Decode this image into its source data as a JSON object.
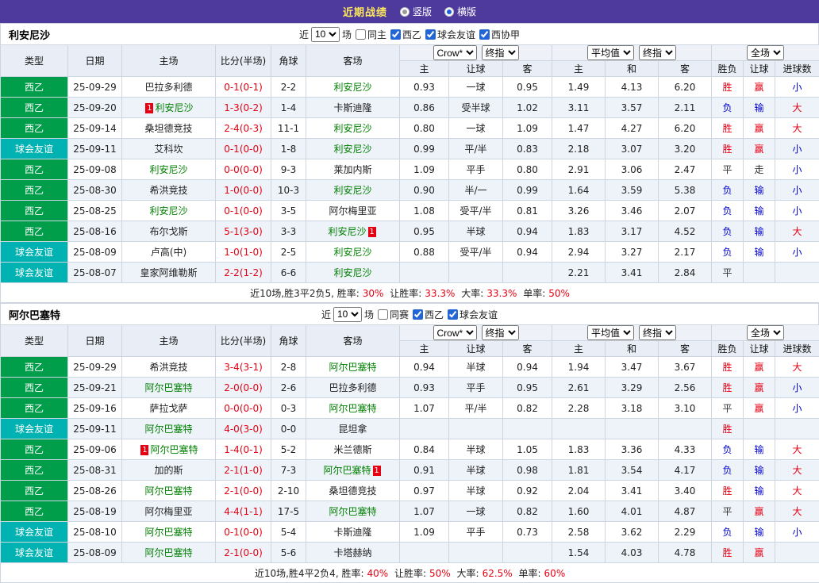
{
  "topbar": {
    "title": "近期战绩",
    "vertical_label": "竖版",
    "horizontal_label": "横版",
    "selected": "横版"
  },
  "colors": {
    "topbar_bg": "#4e3a9c",
    "title_text": "#ffe95e",
    "league_green": "#009e4a",
    "friendly_teal": "#00b2b2",
    "focal_team_green": "#008000",
    "win_red": "#e60012",
    "lose_blue": "#0000cc"
  },
  "controls": {
    "bookmaker": "Crow*",
    "final_odds": "终指",
    "average": "平均值",
    "final_odds2": "终指",
    "scope": "全场"
  },
  "columns": {
    "type": "类型",
    "date": "日期",
    "home": "主场",
    "score": "比分(半场)",
    "corner": "角球",
    "away": "客场",
    "odds_home": "主",
    "odds_handicap": "让球",
    "odds_away": "客",
    "avg_home": "主",
    "avg_draw": "和",
    "avg_away": "客",
    "result": "胜负",
    "cover": "让球",
    "goals": "进球数"
  },
  "sections": [
    {
      "team": "利安尼沙",
      "filter": {
        "prefix": "近",
        "count": "10",
        "suffix": "场",
        "checkboxes": [
          {
            "label": "同主",
            "checked": false
          },
          {
            "label": "西乙",
            "checked": true
          },
          {
            "label": "球会友谊",
            "checked": true
          },
          {
            "label": "西协甲",
            "checked": true
          }
        ]
      },
      "rows": [
        {
          "lg": "西乙",
          "lgc": "g",
          "date": "25-09-29",
          "hcard": "",
          "h": "巴拉多利德",
          "hcls": "",
          "score": "0-1(0-1)",
          "corner": "2-2",
          "a": "利安尼沙",
          "acls": "focal",
          "acard": "",
          "o1": "0.93",
          "hd": "一球",
          "o2": "0.95",
          "a1": "1.49",
          "a2": "4.13",
          "a3": "6.20",
          "res": "胜",
          "resc": "r",
          "cov": "赢",
          "covc": "r",
          "gl": "小",
          "glc": "b"
        },
        {
          "lg": "西乙",
          "lgc": "g",
          "date": "25-09-20",
          "hcard": "1",
          "h": "利安尼沙",
          "hcls": "focal",
          "score": "1-3(0-2)",
          "corner": "1-4",
          "a": "卡斯迪隆",
          "acls": "",
          "acard": "",
          "o1": "0.86",
          "hd": "受半球",
          "o2": "1.02",
          "a1": "3.11",
          "a2": "3.57",
          "a3": "2.11",
          "res": "负",
          "resc": "b",
          "cov": "输",
          "covc": "b",
          "gl": "大",
          "glc": "r"
        },
        {
          "lg": "西乙",
          "lgc": "g",
          "date": "25-09-14",
          "hcard": "",
          "h": "桑坦德竞技",
          "hcls": "",
          "score": "2-4(0-3)",
          "corner": "11-1",
          "a": "利安尼沙",
          "acls": "focal",
          "acard": "",
          "o1": "0.80",
          "hd": "一球",
          "o2": "1.09",
          "a1": "1.47",
          "a2": "4.27",
          "a3": "6.20",
          "res": "胜",
          "resc": "r",
          "cov": "赢",
          "covc": "r",
          "gl": "大",
          "glc": "r"
        },
        {
          "lg": "球会友谊",
          "lgc": "t",
          "date": "25-09-11",
          "hcard": "",
          "h": "艾科坎",
          "hcls": "",
          "score": "0-1(0-0)",
          "corner": "1-8",
          "a": "利安尼沙",
          "acls": "focal",
          "acard": "",
          "o1": "0.99",
          "hd": "平/半",
          "o2": "0.83",
          "a1": "2.18",
          "a2": "3.07",
          "a3": "3.20",
          "res": "胜",
          "resc": "r",
          "cov": "赢",
          "covc": "r",
          "gl": "小",
          "glc": "b"
        },
        {
          "lg": "西乙",
          "lgc": "g",
          "date": "25-09-08",
          "hcard": "",
          "h": "利安尼沙",
          "hcls": "focal",
          "score": "0-0(0-0)",
          "corner": "9-3",
          "a": "莱加内斯",
          "acls": "",
          "acard": "",
          "o1": "1.09",
          "hd": "平手",
          "o2": "0.80",
          "a1": "2.91",
          "a2": "3.06",
          "a3": "2.47",
          "res": "平",
          "resc": "k",
          "cov": "走",
          "covc": "k",
          "gl": "小",
          "glc": "b"
        },
        {
          "lg": "西乙",
          "lgc": "g",
          "date": "25-08-30",
          "hcard": "",
          "h": "希洪竞技",
          "hcls": "",
          "score": "1-0(0-0)",
          "corner": "10-3",
          "a": "利安尼沙",
          "acls": "focal",
          "acard": "",
          "o1": "0.90",
          "hd": "半/一",
          "o2": "0.99",
          "a1": "1.64",
          "a2": "3.59",
          "a3": "5.38",
          "res": "负",
          "resc": "b",
          "cov": "输",
          "covc": "b",
          "gl": "小",
          "glc": "b"
        },
        {
          "lg": "西乙",
          "lgc": "g",
          "date": "25-08-25",
          "hcard": "",
          "h": "利安尼沙",
          "hcls": "focal",
          "score": "0-1(0-0)",
          "corner": "3-5",
          "a": "阿尔梅里亚",
          "acls": "",
          "acard": "",
          "o1": "1.08",
          "hd": "受平/半",
          "o2": "0.81",
          "a1": "3.26",
          "a2": "3.46",
          "a3": "2.07",
          "res": "负",
          "resc": "b",
          "cov": "输",
          "covc": "b",
          "gl": "小",
          "glc": "b"
        },
        {
          "lg": "西乙",
          "lgc": "g",
          "date": "25-08-16",
          "hcard": "",
          "h": "布尔戈斯",
          "hcls": "",
          "score": "5-1(3-0)",
          "corner": "3-3",
          "a": "利安尼沙",
          "acls": "focal",
          "acard": "1",
          "o1": "0.95",
          "hd": "半球",
          "o2": "0.94",
          "a1": "1.83",
          "a2": "3.17",
          "a3": "4.52",
          "res": "负",
          "resc": "b",
          "cov": "输",
          "covc": "b",
          "gl": "大",
          "glc": "r"
        },
        {
          "lg": "球会友谊",
          "lgc": "t",
          "date": "25-08-09",
          "hcard": "",
          "h": "卢高(中)",
          "hcls": "",
          "score": "1-0(1-0)",
          "corner": "2-5",
          "a": "利安尼沙",
          "acls": "focal",
          "acard": "",
          "o1": "0.88",
          "hd": "受平/半",
          "o2": "0.94",
          "a1": "2.94",
          "a2": "3.27",
          "a3": "2.17",
          "res": "负",
          "resc": "b",
          "cov": "输",
          "covc": "b",
          "gl": "小",
          "glc": "b"
        },
        {
          "lg": "球会友谊",
          "lgc": "t",
          "date": "25-08-07",
          "hcard": "",
          "h": "皇家阿维勒斯",
          "hcls": "",
          "score": "2-2(1-2)",
          "corner": "6-6",
          "a": "利安尼沙",
          "acls": "focal",
          "acard": "",
          "o1": "",
          "hd": "",
          "o2": "",
          "a1": "2.21",
          "a2": "3.41",
          "a3": "2.84",
          "res": "平",
          "resc": "k",
          "cov": "",
          "covc": "",
          "gl": "",
          "glc": ""
        }
      ],
      "summary": {
        "lead": "近10场,胜3平2负5, 胜率:",
        "win_rate": "30%",
        "l2": " 让胜率:",
        "cover_rate": "33.3%",
        "l3": " 大率:",
        "big_rate": "33.3%",
        "l4": " 单率:",
        "odd_rate": "50%"
      }
    },
    {
      "team": "阿尔巴塞特",
      "filter": {
        "prefix": "近",
        "count": "10",
        "suffix": "场",
        "checkboxes": [
          {
            "label": "同赛",
            "checked": false
          },
          {
            "label": "西乙",
            "checked": true
          },
          {
            "label": "球会友谊",
            "checked": true
          }
        ]
      },
      "rows": [
        {
          "lg": "西乙",
          "lgc": "g",
          "date": "25-09-29",
          "hcard": "",
          "h": "希洪竞技",
          "hcls": "",
          "score": "3-4(3-1)",
          "corner": "2-8",
          "a": "阿尔巴塞特",
          "acls": "focal",
          "acard": "",
          "o1": "0.94",
          "hd": "半球",
          "o2": "0.94",
          "a1": "1.94",
          "a2": "3.47",
          "a3": "3.67",
          "res": "胜",
          "resc": "r",
          "cov": "赢",
          "covc": "r",
          "gl": "大",
          "glc": "r"
        },
        {
          "lg": "西乙",
          "lgc": "g",
          "date": "25-09-21",
          "hcard": "",
          "h": "阿尔巴塞特",
          "hcls": "focal",
          "score": "2-0(0-0)",
          "corner": "2-6",
          "a": "巴拉多利德",
          "acls": "",
          "acard": "",
          "o1": "0.93",
          "hd": "平手",
          "o2": "0.95",
          "a1": "2.61",
          "a2": "3.29",
          "a3": "2.56",
          "res": "胜",
          "resc": "r",
          "cov": "赢",
          "covc": "r",
          "gl": "小",
          "glc": "b"
        },
        {
          "lg": "西乙",
          "lgc": "g",
          "date": "25-09-16",
          "hcard": "",
          "h": "萨拉戈萨",
          "hcls": "",
          "score": "0-0(0-0)",
          "corner": "0-3",
          "a": "阿尔巴塞特",
          "acls": "focal",
          "acard": "",
          "o1": "1.07",
          "hd": "平/半",
          "o2": "0.82",
          "a1": "2.28",
          "a2": "3.18",
          "a3": "3.10",
          "res": "平",
          "resc": "k",
          "cov": "赢",
          "covc": "r",
          "gl": "小",
          "glc": "b"
        },
        {
          "lg": "球会友谊",
          "lgc": "t",
          "date": "25-09-11",
          "hcard": "",
          "h": "阿尔巴塞特",
          "hcls": "focal",
          "score": "4-0(3-0)",
          "corner": "0-0",
          "a": "昆坦拿",
          "acls": "",
          "acard": "",
          "o1": "",
          "hd": "",
          "o2": "",
          "a1": "",
          "a2": "",
          "a3": "",
          "res": "胜",
          "resc": "r",
          "cov": "",
          "covc": "",
          "gl": "",
          "glc": ""
        },
        {
          "lg": "西乙",
          "lgc": "g",
          "date": "25-09-06",
          "hcard": "1",
          "h": "阿尔巴塞特",
          "hcls": "focal",
          "score": "1-4(0-1)",
          "corner": "5-2",
          "a": "米兰德斯",
          "acls": "",
          "acard": "",
          "o1": "0.84",
          "hd": "半球",
          "o2": "1.05",
          "a1": "1.83",
          "a2": "3.36",
          "a3": "4.33",
          "res": "负",
          "resc": "b",
          "cov": "输",
          "covc": "b",
          "gl": "大",
          "glc": "r"
        },
        {
          "lg": "西乙",
          "lgc": "g",
          "date": "25-08-31",
          "hcard": "",
          "h": "加的斯",
          "hcls": "",
          "score": "2-1(1-0)",
          "corner": "7-3",
          "a": "阿尔巴塞特",
          "acls": "focal",
          "acard": "1",
          "o1": "0.91",
          "hd": "半球",
          "o2": "0.98",
          "a1": "1.81",
          "a2": "3.54",
          "a3": "4.17",
          "res": "负",
          "resc": "b",
          "cov": "输",
          "covc": "b",
          "gl": "大",
          "glc": "r"
        },
        {
          "lg": "西乙",
          "lgc": "g",
          "date": "25-08-26",
          "hcard": "",
          "h": "阿尔巴塞特",
          "hcls": "focal",
          "score": "2-1(0-0)",
          "corner": "2-10",
          "a": "桑坦德竞技",
          "acls": "",
          "acard": "",
          "o1": "0.97",
          "hd": "半球",
          "o2": "0.92",
          "a1": "2.04",
          "a2": "3.41",
          "a3": "3.40",
          "res": "胜",
          "resc": "r",
          "cov": "输",
          "covc": "b",
          "gl": "大",
          "glc": "r"
        },
        {
          "lg": "西乙",
          "lgc": "g",
          "date": "25-08-19",
          "hcard": "",
          "h": "阿尔梅里亚",
          "hcls": "",
          "score": "4-4(1-1)",
          "corner": "17-5",
          "a": "阿尔巴塞特",
          "acls": "focal",
          "acard": "",
          "o1": "1.07",
          "hd": "一球",
          "o2": "0.82",
          "a1": "1.60",
          "a2": "4.01",
          "a3": "4.87",
          "res": "平",
          "resc": "k",
          "cov": "赢",
          "covc": "r",
          "gl": "大",
          "glc": "r"
        },
        {
          "lg": "球会友谊",
          "lgc": "t",
          "date": "25-08-10",
          "hcard": "",
          "h": "阿尔巴塞特",
          "hcls": "focal",
          "score": "0-1(0-0)",
          "corner": "5-4",
          "a": "卡斯迪隆",
          "acls": "",
          "acard": "",
          "o1": "1.09",
          "hd": "平手",
          "o2": "0.73",
          "a1": "2.58",
          "a2": "3.62",
          "a3": "2.29",
          "res": "负",
          "resc": "b",
          "cov": "输",
          "covc": "b",
          "gl": "小",
          "glc": "b"
        },
        {
          "lg": "球会友谊",
          "lgc": "t",
          "date": "25-08-09",
          "hcard": "",
          "h": "阿尔巴塞特",
          "hcls": "focal",
          "score": "2-1(0-0)",
          "corner": "5-6",
          "a": "卡塔赫纳",
          "acls": "",
          "acard": "",
          "o1": "",
          "hd": "",
          "o2": "",
          "a1": "1.54",
          "a2": "4.03",
          "a3": "4.78",
          "res": "胜",
          "resc": "r",
          "cov": "赢",
          "covc": "r",
          "gl": "",
          "glc": ""
        }
      ],
      "summary": {
        "lead": "近10场,胜4平2负4, 胜率:",
        "win_rate": "40%",
        "l2": " 让胜率:",
        "cover_rate": "50%",
        "l3": " 大率:",
        "big_rate": "62.5%",
        "l4": " 单率:",
        "odd_rate": "60%"
      }
    }
  ]
}
